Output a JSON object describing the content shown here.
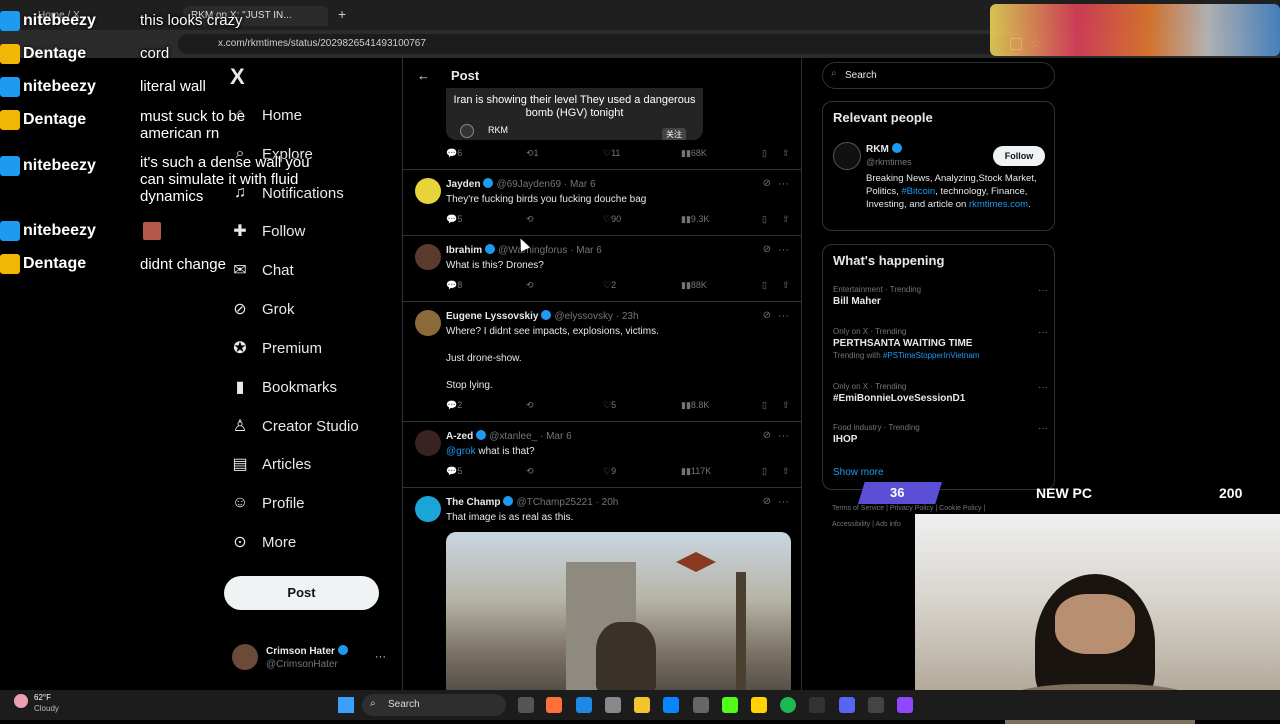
{
  "browser": {
    "tabs": [
      "Home / X",
      "RKM on X: \"JUST IN..."
    ],
    "new_tab": "+",
    "url": "x.com/rkmtimes/status/2029826541493100767"
  },
  "nav": {
    "logo": "X",
    "items": [
      {
        "label": "Home",
        "icon": "home-icon"
      },
      {
        "label": "Explore",
        "icon": "search-icon"
      },
      {
        "label": "Notifications",
        "icon": "bell-icon"
      },
      {
        "label": "Follow",
        "icon": "add-user-icon"
      },
      {
        "label": "Chat",
        "icon": "mail-icon"
      },
      {
        "label": "Grok",
        "icon": "grok-icon"
      },
      {
        "label": "Premium",
        "icon": "premium-icon"
      },
      {
        "label": "Bookmarks",
        "icon": "bookmark-icon"
      },
      {
        "label": "Creator Studio",
        "icon": "creator-icon"
      },
      {
        "label": "Articles",
        "icon": "article-icon"
      },
      {
        "label": "Profile",
        "icon": "profile-icon"
      },
      {
        "label": "More",
        "icon": "more-icon"
      }
    ],
    "post_button": "Post",
    "account": {
      "name": "Crimson Hater",
      "handle": "@CrimsonHater",
      "more": "···"
    }
  },
  "header": {
    "back": "←",
    "title": "Post"
  },
  "quoted": {
    "text": "Iran is showing their level They used a dangerous bomb (HGV) tonight",
    "author": "RKM",
    "badge": "关注"
  },
  "top_actions": {
    "replies": "6",
    "reposts": "1",
    "likes": "11",
    "views": "68K"
  },
  "replies": [
    {
      "name": "Jayden",
      "handle": "@69Jayden69",
      "time": "Mar 6",
      "text": "They're fucking birds you fucking douche bag",
      "replies": "5",
      "reposts": "",
      "likes": "90",
      "views": "9.3K"
    },
    {
      "name": "Ibrahim",
      "handle": "@Warningforus",
      "time": "Mar 6",
      "text": "What is this? Drones?",
      "replies": "8",
      "reposts": "",
      "likes": "2",
      "views": "88K"
    },
    {
      "name": "Eugene Lyssovskiy",
      "handle": "@elyssovsky",
      "time": "23h",
      "text_lines": [
        "Where? I didnt see impacts, explosions, victims.",
        "Just drone-show.",
        "Stop lying."
      ],
      "replies": "2",
      "reposts": "",
      "likes": "5",
      "views": "8.8K"
    },
    {
      "name": "A-zed",
      "handle": "@xtanlee_",
      "time": "Mar 6",
      "mention": "@grok",
      "text": "what is that?",
      "replies": "5",
      "reposts": "",
      "likes": "9",
      "views": "117K"
    },
    {
      "name": "The Champ",
      "handle": "@TChamp25221",
      "time": "20h",
      "text": "That image is as real as this."
    }
  ],
  "search": {
    "placeholder": "Search"
  },
  "relevant": {
    "title": "Relevant people",
    "name": "RKM",
    "handle": "@rkmtimes",
    "follow": "Follow",
    "bio_1": "Breaking News, Analyzing,Stock Market, Politics, ",
    "bio_tag": "#Bitcoin",
    "bio_2": ", technology, Finance, Investing, and article on ",
    "bio_link": "rkmtimes.com",
    "bio_end": "."
  },
  "happening": {
    "title": "What's happening",
    "trends": [
      {
        "cat": "Entertainment · Trending",
        "name": "Bill Maher",
        "sub": ""
      },
      {
        "cat": "Only on X · Trending",
        "name": "PERTHSANTA WAITING TIME",
        "sub": "Trending with ",
        "sub_tag": "#PSTimeStopperInVietnam"
      },
      {
        "cat": "Only on X · Trending",
        "name": "#EmiBonnieLoveSessionD1",
        "sub": ""
      },
      {
        "cat": "Food industry · Trending",
        "name": "IHOP",
        "sub": ""
      }
    ],
    "show_more": "Show more"
  },
  "footer_links": [
    "Terms of Service",
    "Privacy Policy",
    "Cookie Policy",
    "Accessibility",
    "Ads info"
  ],
  "stream_overlay": {
    "goal_left": "36",
    "goal_title": "NEW PC",
    "goal_right": "200",
    "chat": [
      {
        "user": "nitebeezy",
        "msg": "this looks crazy",
        "type": "x"
      },
      {
        "user": "Dentage",
        "msg": "cord",
        "type": "crown"
      },
      {
        "user": "nitebeezy",
        "msg": "literal wall",
        "type": "x"
      },
      {
        "user": "Dentage",
        "msg": "must suck to be american rn",
        "type": "crown"
      },
      {
        "user": "nitebeezy",
        "msg": "it's such a dense wall you can simulate it with fluid dynamics",
        "type": "x"
      },
      {
        "user": "nitebeezy",
        "msg": "",
        "type": "x"
      },
      {
        "user": "Dentage",
        "msg": "didnt change",
        "type": "crown"
      }
    ]
  },
  "taskbar": {
    "weather_temp": "62°F",
    "weather_desc": "Cloudy",
    "search": "Search"
  },
  "colors": {
    "accent": "#1d9bf0",
    "bg": "#000000",
    "border": "#2f3336",
    "muted": "#71767b",
    "goal": "#5b4fd6"
  }
}
